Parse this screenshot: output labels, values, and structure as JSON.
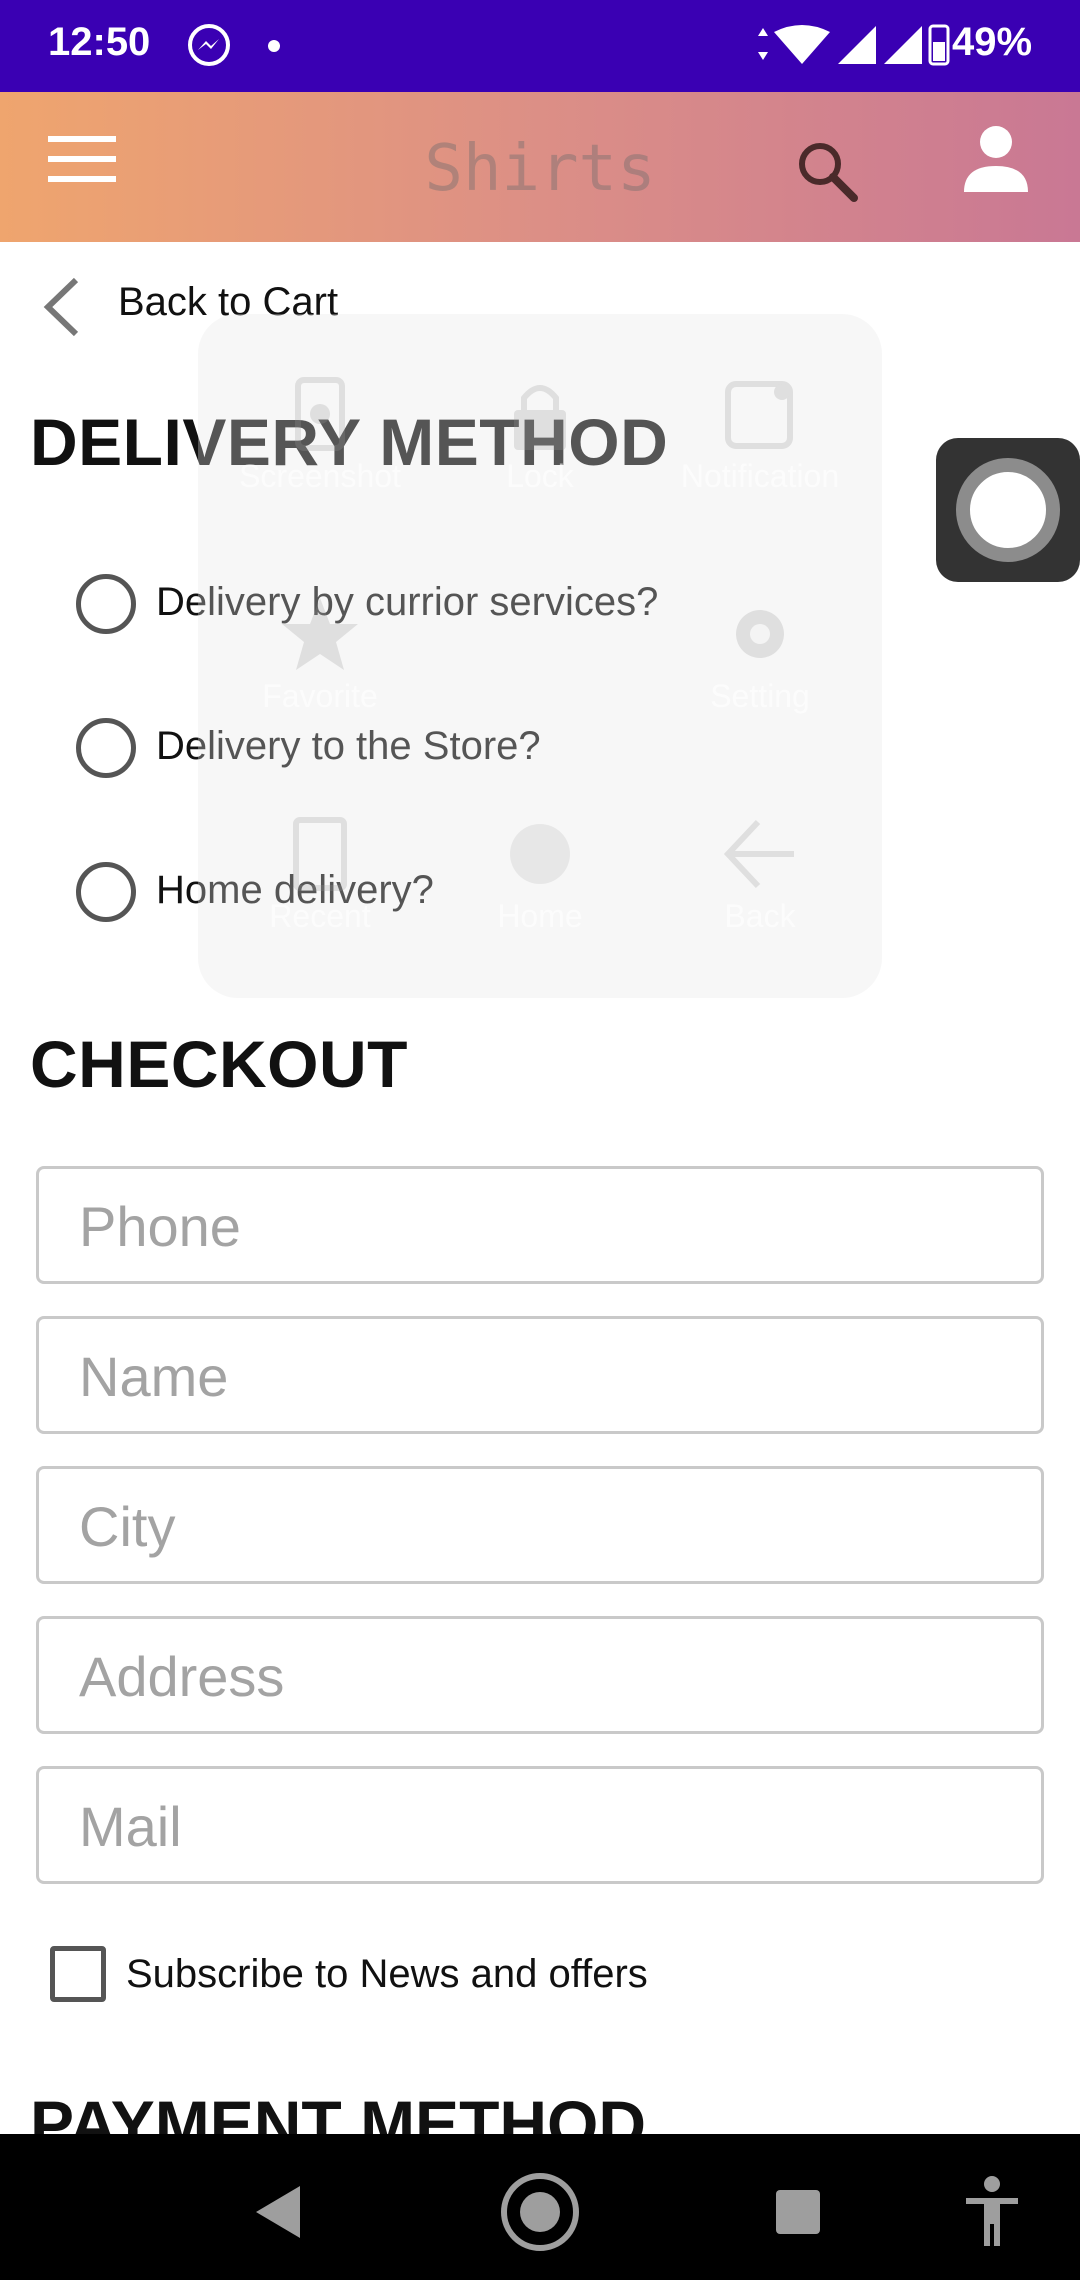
{
  "status_bar": {
    "time": "12:50",
    "battery_percent": "49%",
    "icons": [
      "messenger-icon",
      "notification-dot",
      "data-arrows-icon",
      "wifi-icon",
      "signal-icon",
      "battery-icon"
    ]
  },
  "app_bar": {
    "title": "Shirts",
    "gradient": [
      "#efa56e",
      "#c97894"
    ]
  },
  "nav": {
    "back_label": "Back to Cart"
  },
  "delivery": {
    "heading": "DELIVERY METHOD",
    "options": [
      {
        "label": "Delivery by currior services?",
        "selected": false
      },
      {
        "label": "Delivery to the Store?",
        "selected": false
      },
      {
        "label": "Home delivery?",
        "selected": false
      }
    ]
  },
  "checkout": {
    "heading": "CHECKOUT",
    "fields": [
      {
        "placeholder": "Phone",
        "value": ""
      },
      {
        "placeholder": "Name",
        "value": ""
      },
      {
        "placeholder": "City",
        "value": ""
      },
      {
        "placeholder": "Address",
        "value": ""
      },
      {
        "placeholder": "Mail",
        "value": ""
      }
    ],
    "subscribe_label": "Subscribe to News and offers",
    "subscribe_checked": false
  },
  "payment": {
    "heading": "PAYMENT METHOD"
  },
  "assistive_menu": {
    "items": [
      "Screenshot",
      "Lock",
      "Notification",
      "Favorite",
      "Setting",
      "Recent",
      "Home",
      "Back"
    ]
  },
  "colors": {
    "status_bar": "#3a00b3",
    "nav_bar": "#000000"
  }
}
